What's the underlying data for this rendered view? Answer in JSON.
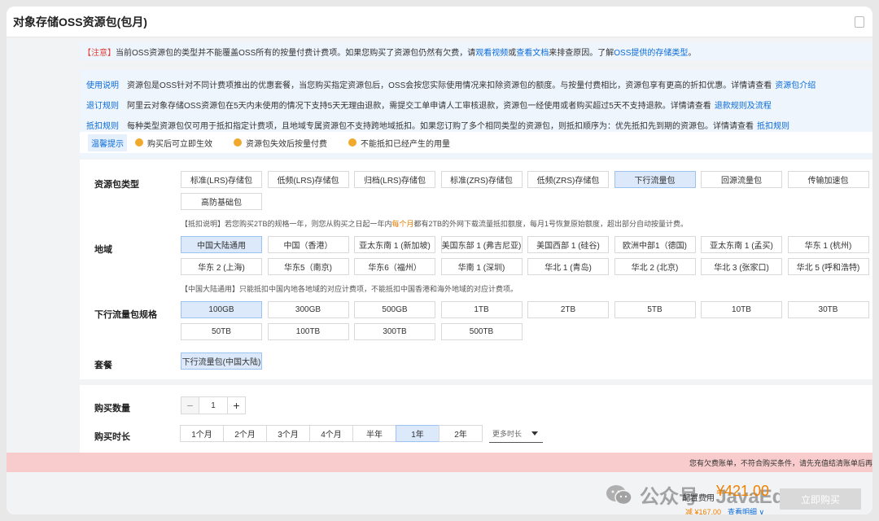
{
  "window": {
    "title": "对象存储OSS资源包(包月)"
  },
  "notice": {
    "tag": "【注意】",
    "text1": "当前OSS资源包的类型并不能覆盖OSS所有的按量付费计费项。如果您购买了资源包仍然有欠费，请",
    "link1": "观看视频",
    "or": "或",
    "link2": "查看文档",
    "text2": "来排查原因。了解",
    "link3": "OSS提供的存储类型",
    "end": "。"
  },
  "info": [
    {
      "label": "使用说明",
      "text": "资源包是OSS针对不同计费项推出的优惠套餐，当您购买指定资源包后，OSS会按您实际使用情况来扣除资源包的额度。与按量付费相比，资源包享有更高的折扣优惠。详情请查看",
      "link": "资源包介绍"
    },
    {
      "label": "退订规则",
      "text": "阿里云对象存储OSS资源包在5天内未使用的情况下支持5天无理由退款，需提交工单申请人工审核退款，资源包一经使用或者购买超过5天不支持退款。详情请查看",
      "link": "退款规则及流程"
    },
    {
      "label": "抵扣规则",
      "text": "每种类型资源包仅可用于抵扣指定计费项，且地域专属资源包不支持跨地域抵扣。如果您订购了多个相同类型的资源包，则抵扣顺序为：优先抵扣先到期的资源包。详情请查看",
      "link": "抵扣规则"
    }
  ],
  "tips": {
    "label": "温馨提示",
    "items": [
      "购买后可立即生效",
      "资源包失效后按量付费",
      "不能抵扣已经产生的用量"
    ]
  },
  "package_type": {
    "label": "资源包类型",
    "options": [
      "标准(LRS)存储包",
      "低频(LRS)存储包",
      "归档(LRS)存储包",
      "标准(ZRS)存储包",
      "低频(ZRS)存储包",
      "下行流量包",
      "回源流量包",
      "传输加速包",
      "高防基础包"
    ],
    "selected": 5,
    "hint_pre": "【抵扣说明】若您购买2TB的规格一年，则您从购买之日起一年内",
    "hint_hl": "每个月",
    "hint_post": "都有2TB的外网下载流量抵扣额度，每月1号恢复原始额度，超出部分自动按量计费。"
  },
  "region": {
    "label": "地域",
    "options": [
      "中国大陆通用",
      "中国（香港）",
      "亚太东南 1 (新加坡)",
      "美国东部 1 (弗吉尼亚)",
      "美国西部 1 (硅谷)",
      "欧洲中部1（德国)",
      "亚太东南 1 (孟买)",
      "华东 1 (杭州)",
      "华东 2 (上海)",
      "华东5（南京)",
      "华东6（福州）",
      "华南 1 (深圳)",
      "华北 1 (青岛)",
      "华北 2 (北京)",
      "华北 3 (张家口)",
      "华北 5 (呼和浩特)"
    ],
    "selected": 0,
    "hint": "【中国大陆通用】只能抵扣中国内地各地域的对应计费项，不能抵扣中国香港和海外地域的对应计费项。"
  },
  "spec": {
    "label": "下行流量包规格",
    "options": [
      "100GB",
      "300GB",
      "500GB",
      "1TB",
      "2TB",
      "5TB",
      "10TB",
      "30TB",
      "50TB",
      "100TB",
      "300TB",
      "500TB"
    ],
    "selected": 0
  },
  "plan": {
    "label": "套餐",
    "value": "下行流量包(中国大陆)"
  },
  "quantity": {
    "label": "购买数量",
    "value": "1",
    "minus": "−",
    "plus": "+"
  },
  "duration": {
    "label": "购买时长",
    "options": [
      "1个月",
      "2个月",
      "3个月",
      "4个月",
      "半年",
      "1年",
      "2年"
    ],
    "selected": 5,
    "more": "更多时长"
  },
  "warning": "您有欠费账单，不符合购买条件，请先充值结清账单后再",
  "footer": {
    "fee_label": "配置费用",
    "fee_value": "¥421.00",
    "save": "减 ¥167.00",
    "detail": "查看明细 ∨",
    "buy": "立即购买"
  },
  "watermark": "公众号 · JavaEdge"
}
